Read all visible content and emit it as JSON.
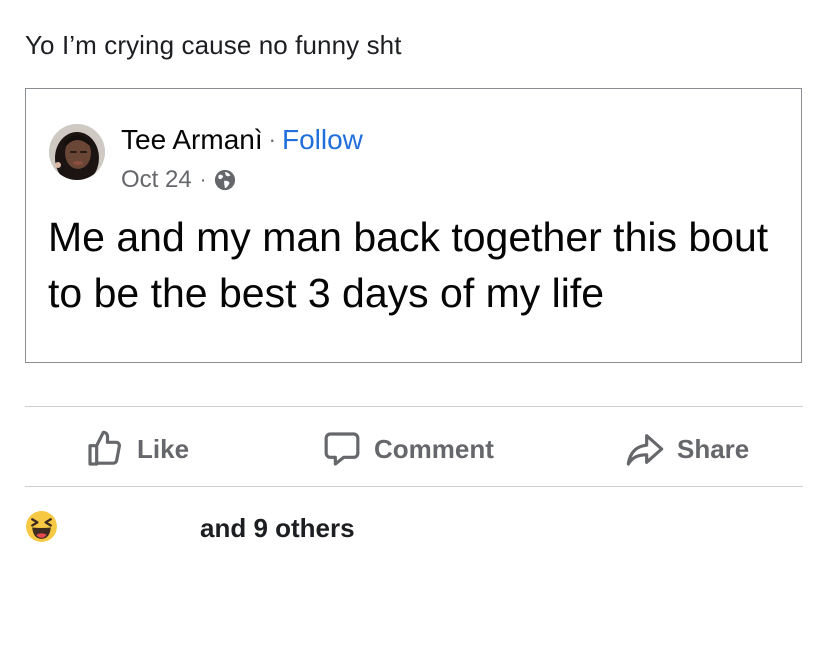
{
  "caption": "Yo I’m crying cause no funny sht",
  "shared_post": {
    "author": "Tee Armanì",
    "separator": "·",
    "follow_label": "Follow",
    "date": "Oct 24",
    "audience_icon": "globe-icon",
    "text": "Me and my man back together this bout to be the best 3 days of my life"
  },
  "actions": {
    "like_label": "Like",
    "comment_label": "Comment",
    "share_label": "Share"
  },
  "reactions": {
    "emoji": "laughing-face-emoji",
    "text": "and 9 others"
  },
  "colors": {
    "link": "#216fdb",
    "secondary_text": "#65676b",
    "divider": "#ced0d4"
  }
}
